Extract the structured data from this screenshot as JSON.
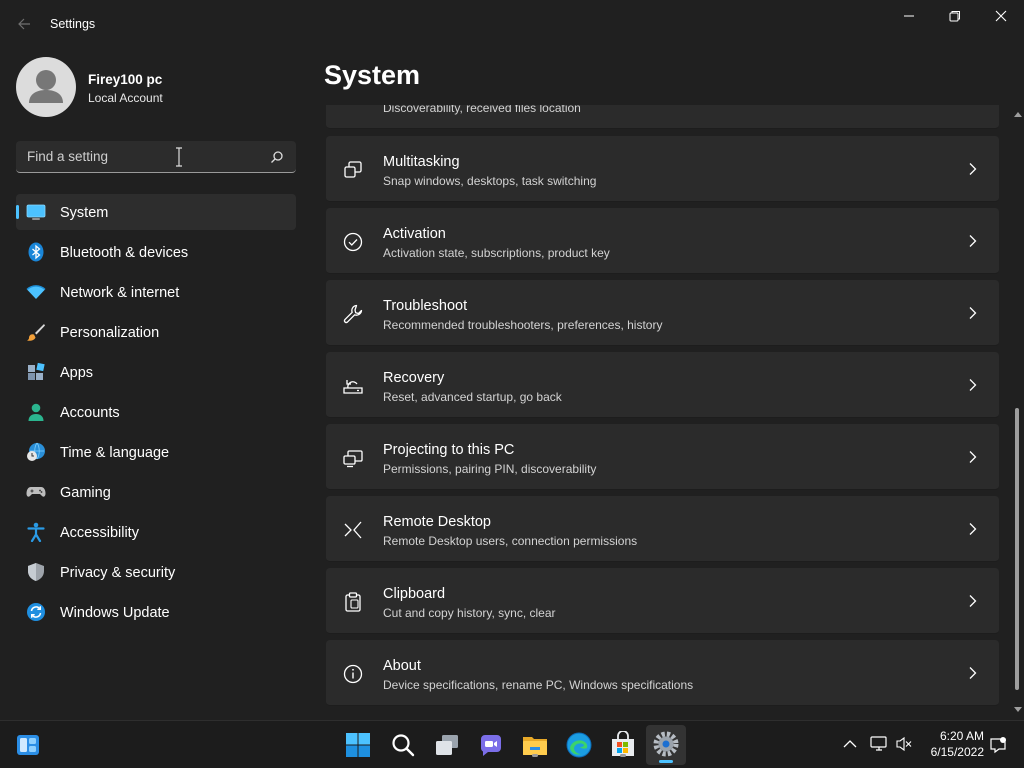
{
  "window": {
    "title": "Settings"
  },
  "user": {
    "name": "Firey100 pc",
    "account_type": "Local Account"
  },
  "search": {
    "placeholder": "Find a setting"
  },
  "nav": [
    {
      "label": "System",
      "icon": "monitor-icon",
      "active": true
    },
    {
      "label": "Bluetooth & devices",
      "icon": "bluetooth-icon"
    },
    {
      "label": "Network & internet",
      "icon": "wifi-icon"
    },
    {
      "label": "Personalization",
      "icon": "brush-icon"
    },
    {
      "label": "Apps",
      "icon": "apps-icon"
    },
    {
      "label": "Accounts",
      "icon": "person-icon"
    },
    {
      "label": "Time & language",
      "icon": "globe-clock-icon"
    },
    {
      "label": "Gaming",
      "icon": "gamepad-icon"
    },
    {
      "label": "Accessibility",
      "icon": "accessibility-icon"
    },
    {
      "label": "Privacy & security",
      "icon": "shield-icon"
    },
    {
      "label": "Windows Update",
      "icon": "update-icon"
    }
  ],
  "main": {
    "title": "System",
    "partial_card": {
      "subtitle": "Discoverability, received files location"
    },
    "cards": [
      {
        "title": "Multitasking",
        "subtitle": "Snap windows, desktops, task switching",
        "icon": "multitasking-icon"
      },
      {
        "title": "Activation",
        "subtitle": "Activation state, subscriptions, product key",
        "icon": "activation-check-icon"
      },
      {
        "title": "Troubleshoot",
        "subtitle": "Recommended troubleshooters, preferences, history",
        "icon": "wrench-icon"
      },
      {
        "title": "Recovery",
        "subtitle": "Reset, advanced startup, go back",
        "icon": "recovery-icon"
      },
      {
        "title": "Projecting to this PC",
        "subtitle": "Permissions, pairing PIN, discoverability",
        "icon": "projecting-icon"
      },
      {
        "title": "Remote Desktop",
        "subtitle": "Remote Desktop users, connection permissions",
        "icon": "remote-desktop-icon"
      },
      {
        "title": "Clipboard",
        "subtitle": "Cut and copy history, sync, clear",
        "icon": "clipboard-icon"
      },
      {
        "title": "About",
        "subtitle": "Device specifications, rename PC, Windows specifications",
        "icon": "info-icon"
      }
    ]
  },
  "taskbar": {
    "time": "6:20 AM",
    "date": "6/15/2022",
    "apps": [
      "widgets-icon",
      "start-icon",
      "search-icon",
      "task-view-icon",
      "chat-icon",
      "file-explorer-icon",
      "edge-icon",
      "store-icon",
      "settings-icon"
    ]
  },
  "colors": {
    "accent": "#4cc2ff",
    "background": "#202020",
    "card": "#2b2b2b"
  }
}
